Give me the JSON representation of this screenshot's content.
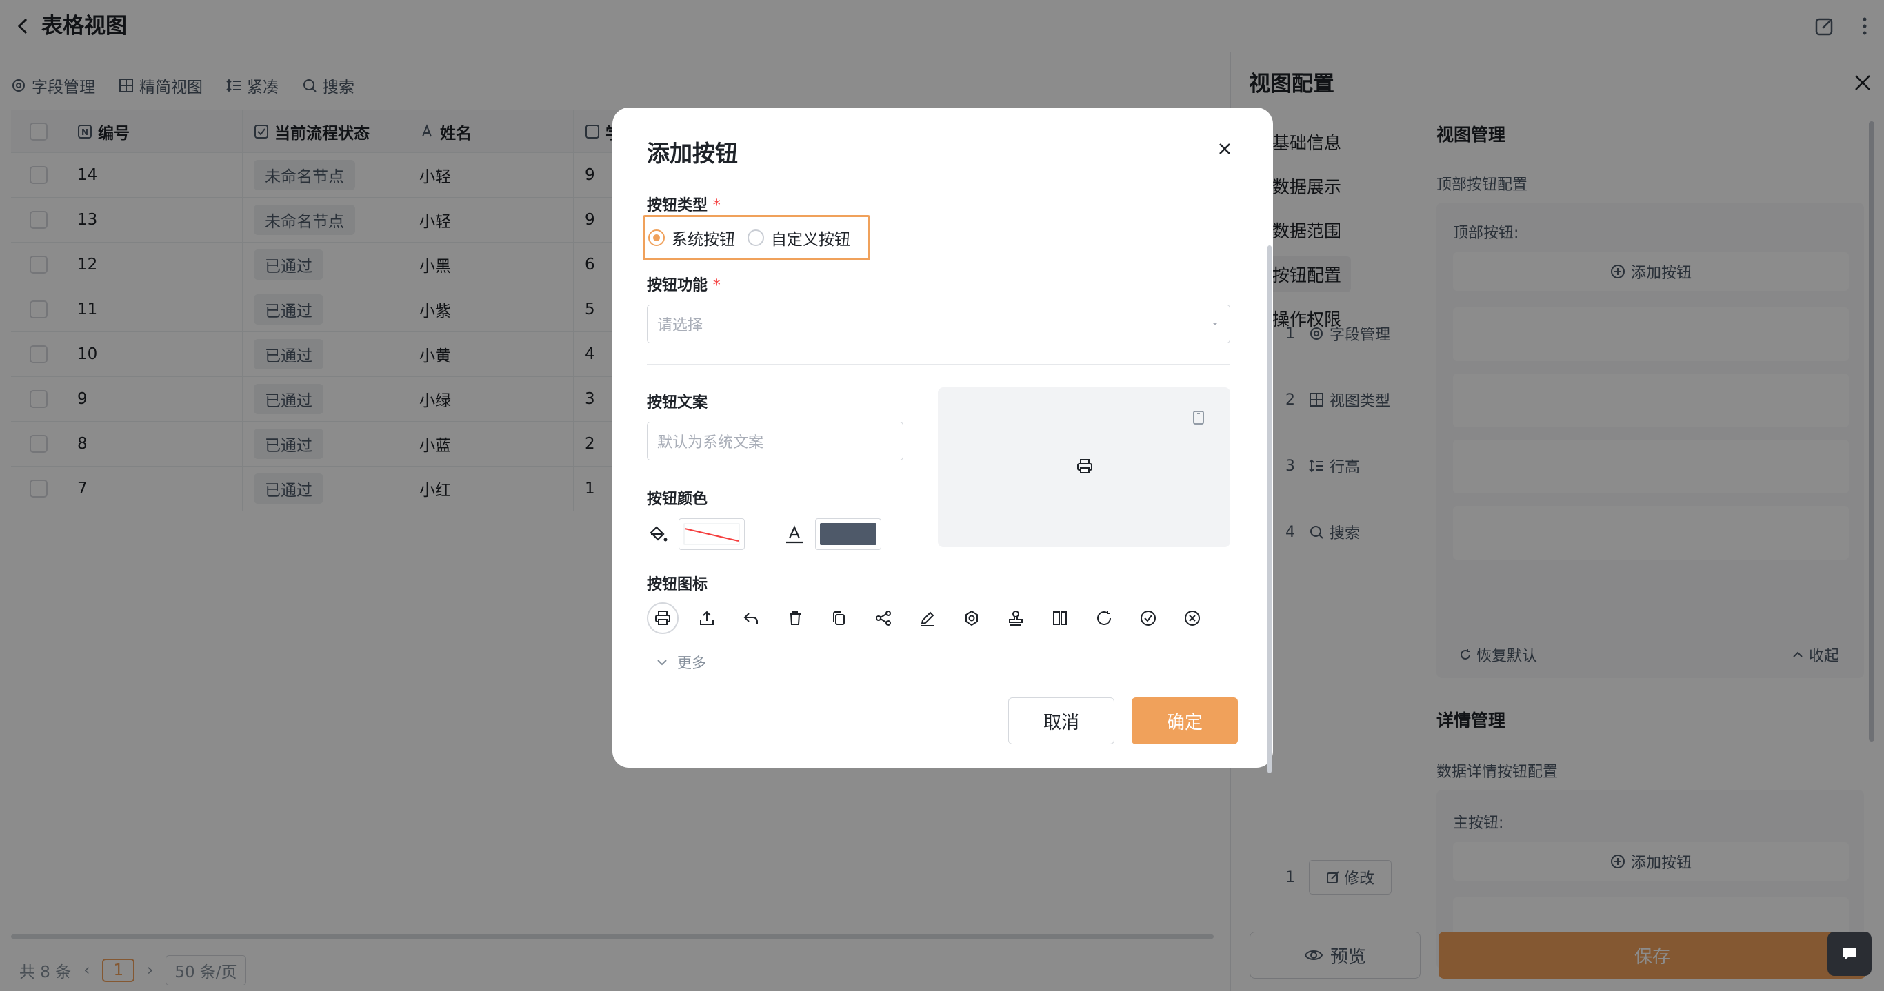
{
  "header": {
    "title": "表格视图"
  },
  "toolbar": {
    "fields": "字段管理",
    "compact_view": "精简视图",
    "row_height": "紧凑",
    "search": "搜索"
  },
  "table": {
    "columns": [
      "编号",
      "当前流程状态",
      "姓名",
      "学"
    ],
    "rows": [
      {
        "id": "14",
        "status": "未命名节点",
        "name": "小轻",
        "score": "9"
      },
      {
        "id": "13",
        "status": "未命名节点",
        "name": "小轻",
        "score": "9"
      },
      {
        "id": "12",
        "status": "已通过",
        "name": "小黑",
        "score": "6"
      },
      {
        "id": "11",
        "status": "已通过",
        "name": "小紫",
        "score": "5"
      },
      {
        "id": "10",
        "status": "已通过",
        "name": "小黄",
        "score": "4"
      },
      {
        "id": "9",
        "status": "已通过",
        "name": "小绿",
        "score": "3"
      },
      {
        "id": "8",
        "status": "已通过",
        "name": "小蓝",
        "score": "2"
      },
      {
        "id": "7",
        "status": "已通过",
        "name": "小红",
        "score": "1"
      }
    ]
  },
  "pager": {
    "total": "共 8 条",
    "page": "1",
    "page_size": "50 条/页"
  },
  "panel": {
    "title": "视图配置",
    "nav": [
      "基础信息",
      "数据展示",
      "数据范围",
      "按钮配置",
      "操作权限"
    ],
    "view_mgmt": "视图管理",
    "top_config": "顶部按钮配置",
    "top_buttons": "顶部按钮:",
    "add_button": "添加按钮",
    "items": [
      {
        "index": "1",
        "label": "字段管理"
      },
      {
        "index": "2",
        "label": "视图类型"
      },
      {
        "index": "3",
        "label": "行高"
      },
      {
        "index": "4",
        "label": "搜索"
      }
    ],
    "restore": "恢复默认",
    "collapse": "收起",
    "detail_mgmt": "详情管理",
    "detail_config": "数据详情按钮配置",
    "main_buttons": "主按钮:",
    "detail_add": "添加按钮",
    "detail_item": {
      "index": "1",
      "label": "修改"
    },
    "preview": "预览",
    "save": "保存"
  },
  "modal": {
    "title": "添加按钮",
    "type_label": "按钮类型",
    "type_options": [
      "系统按钮",
      "自定义按钮"
    ],
    "type_selected": "系统按钮",
    "func_label": "按钮功能",
    "func_placeholder": "请选择",
    "text_label": "按钮文案",
    "text_placeholder": "默认为系统文案",
    "color_label": "按钮颜色",
    "icon_label": "按钮图标",
    "icons": [
      "printer-icon",
      "upload-icon",
      "reply-icon",
      "trash-icon",
      "copy-icon",
      "share-icon",
      "edit-icon",
      "settings-icon",
      "stamp-icon",
      "columns-icon",
      "refresh-icon",
      "check-circle-icon",
      "close-circle-icon"
    ],
    "more": "更多",
    "cancel": "取消",
    "confirm": "确定",
    "accent_color": "#f0a15b",
    "text_color_swatch": "#4e5969"
  }
}
